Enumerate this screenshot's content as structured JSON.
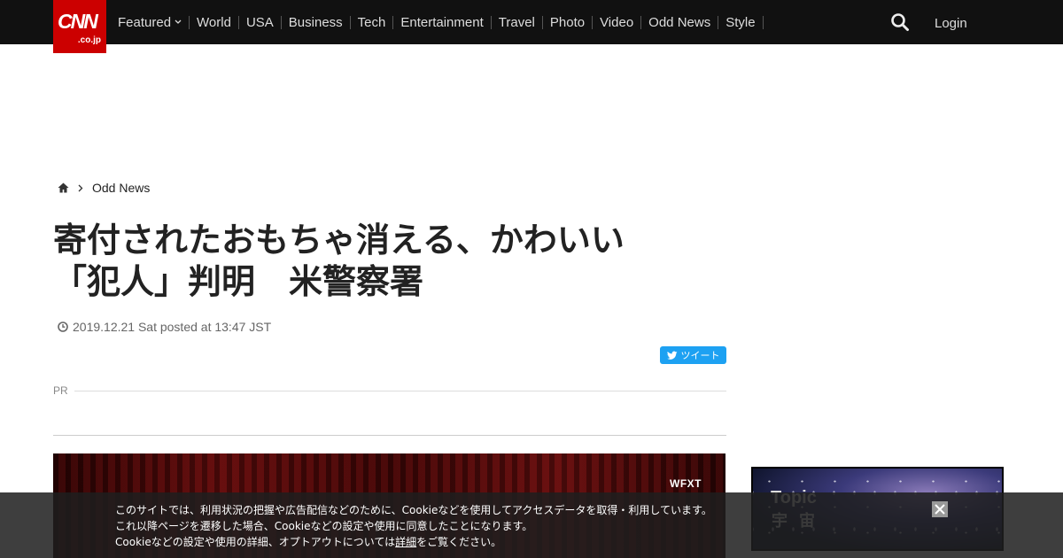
{
  "header": {
    "logo_main": "CNN",
    "logo_sub": ".co.jp",
    "nav": [
      "Featured",
      "World",
      "USA",
      "Business",
      "Tech",
      "Entertainment",
      "Travel",
      "Photo",
      "Video",
      "Odd News",
      "Style"
    ],
    "login_label": "Login"
  },
  "breadcrumb": {
    "section": "Odd News"
  },
  "article": {
    "title_line1": "寄付されたおもちゃ消える、かわいい",
    "title_line2": "「犯人」判明　米警察署",
    "dateline": "2019.12.21 Sat posted at 13:47 JST",
    "tweet_label": "ツイート",
    "pr_label": "PR",
    "media_watermark": "WFXT"
  },
  "sidebar": {
    "topic_label": "Topic",
    "topic_title": "宇 宙"
  },
  "cookie_notice": {
    "line1": "このサイトでは、利用状況の把握や広告配信などのために、Cookieなどを使用してアクセスデータを取得・利用しています。",
    "line2": "これ以降ページを遷移した場合、Cookieなどの設定や使用に同意したことになります。",
    "line3_before": "Cookieなどの設定や使用の詳細、オプトアウトについては",
    "line3_link": "詳細",
    "line3_after": "をご覧ください。"
  },
  "colors": {
    "brand_red": "#cc0000",
    "topbar": "#111111",
    "twitter_blue": "#1da1f2"
  }
}
